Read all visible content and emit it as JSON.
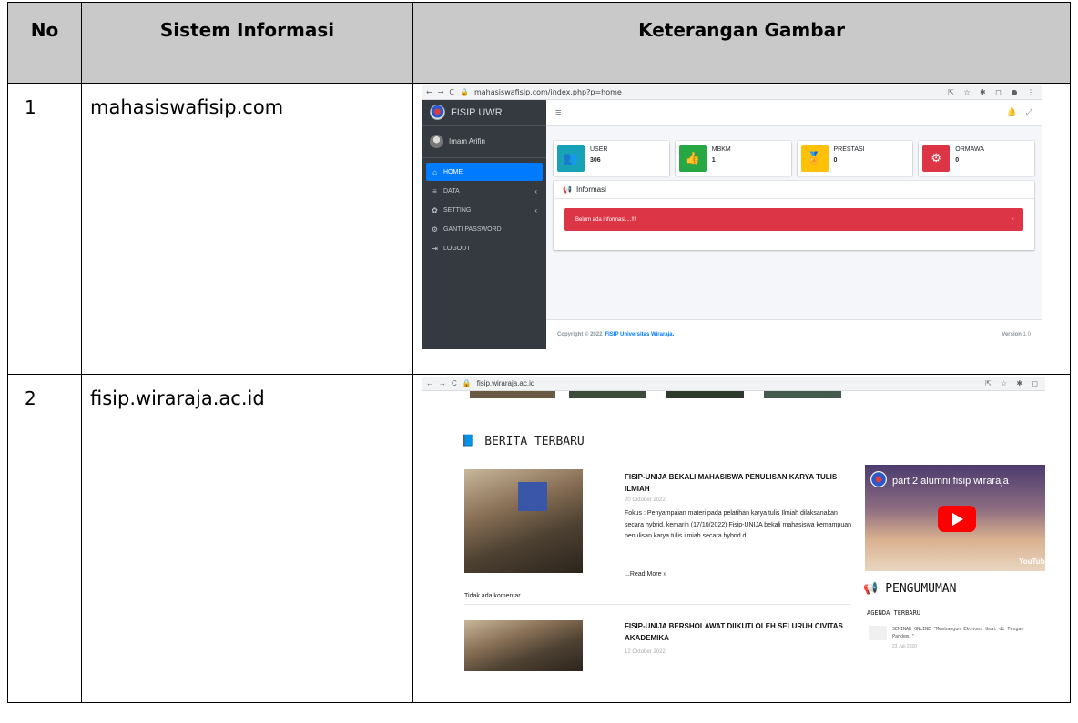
{
  "table": {
    "headers": [
      "No",
      "Sistem Informasi",
      "Keterangan Gambar"
    ],
    "rows": [
      {
        "no": "1",
        "system": "mahasiswafisip.com"
      },
      {
        "no": "2",
        "system": "fisip.wiraraja.ac.id"
      }
    ]
  },
  "shot1": {
    "browser": {
      "url": "mahasiswafisip.com/index.php?p=home",
      "controls": "⇱ ☆ ✱ ◻ ● ⋮"
    },
    "brand": "FISIP UWR",
    "user_name": "Imam Arifin",
    "menu": [
      {
        "icon": "⌂",
        "label": "HOME"
      },
      {
        "icon": "≡",
        "label": "DATA",
        "chevron": "‹"
      },
      {
        "icon": "✿",
        "label": "SETTING",
        "chevron": "‹"
      },
      {
        "icon": "⚙",
        "label": "GANTI PASSWORD"
      },
      {
        "icon": "⇥",
        "label": "LOGOUT"
      }
    ],
    "topnav": {
      "menu_icon": "≡",
      "bell_icon": "🔔",
      "expand_icon": "⤢"
    },
    "info_boxes": [
      {
        "label": "USER",
        "value": "306",
        "color": "#17a2b8",
        "icon": "👥"
      },
      {
        "label": "MBKM",
        "value": "1",
        "color": "#28a745",
        "icon": "👍"
      },
      {
        "label": "PRESTASI",
        "value": "0",
        "color": "#ffc107",
        "icon": "🏅"
      },
      {
        "label": "ORMAWA",
        "value": "0",
        "color": "#dc3545",
        "icon": "⚙"
      }
    ],
    "card_title": "Informasi",
    "alert": "Belum ada informasi....!!!",
    "alert_close": "×",
    "footer": {
      "prefix": "Copyright © 2022",
      "link": "FISIP Universitas Wiraraja.",
      "version_label": "Version",
      "version": "1.0"
    }
  },
  "shot2": {
    "browser": {
      "url": "fisip.wiraraja.ac.id",
      "controls": "⇱ ☆ ✱ ◻"
    },
    "section_title": "BERITA TERBARU",
    "posts": [
      {
        "title": "FISIP-UNIJA BEKALI MAHASISWA PENULISAN KARYA TULIS ILMIAH",
        "date": "20 Oktober 2022",
        "body": "Fokus : Penyampaian materi pada pelatihan karya tulis Ilmiah dilaksanakan secara hybrid, kemarin (17/10/2022) Fisip-UNIJA bekali mahasiswa kemampuan penulisan karya tulis ilmiah secara hybrid di",
        "read_more": "...Read More »",
        "comments": "Tidak ada komentar"
      },
      {
        "title": "FISIP-UNIJA BERSHOLAWAT DIIKUTI OLEH SELURUH CIVITAS AKADEMIKA",
        "date": "12 Oktober 2022"
      }
    ],
    "video": {
      "title": "part 2 alumni fisip wiraraja",
      "brand": "YouTube"
    },
    "pengumuman": "PENGUMUMAN",
    "agenda_title": "AGENDA TERBARU",
    "agenda_item": "SEMINAR ONLINE \"Membangun Ekonomi Umat di Tengah Pandemi\"",
    "agenda_date": "23 Juli 2020"
  }
}
